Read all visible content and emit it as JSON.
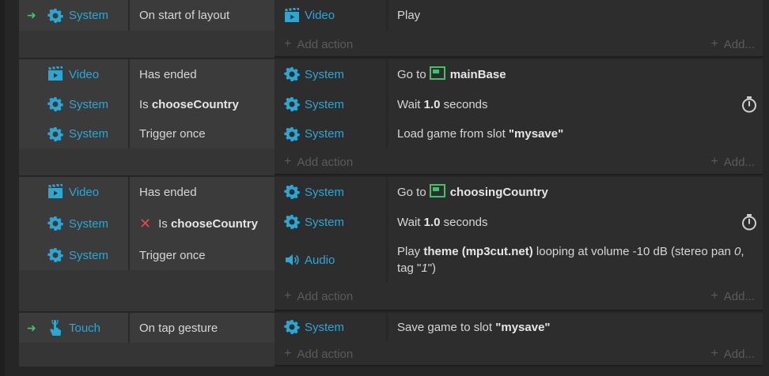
{
  "add_action_label": "Add action",
  "add_right_label": "Add...",
  "colors": {
    "object": "#29a8d6",
    "trigger": "#3fc36a",
    "negate": "#e84848",
    "muted": "#5b5b5b"
  },
  "events": [
    {
      "conditions": [
        {
          "trigger": true,
          "icon": "gear-icon",
          "object": "System",
          "text": "On start of layout"
        }
      ],
      "actions": [
        {
          "icon": "film-icon",
          "object": "Video",
          "text": "Play"
        }
      ]
    },
    {
      "conditions": [
        {
          "icon": "film-icon",
          "object": "Video",
          "text": "Has ended"
        },
        {
          "icon": "gear-icon",
          "object": "System",
          "prefix": "Is",
          "bold": "chooseCountry"
        },
        {
          "icon": "gear-icon",
          "object": "System",
          "text": "Trigger once"
        }
      ],
      "actions": [
        {
          "icon": "gear-icon",
          "object": "System",
          "prefix": "Go to",
          "layout": "mainBase"
        },
        {
          "icon": "gear-icon",
          "object": "System",
          "prefix": "Wait",
          "bold": "1.0",
          "suffix": "seconds",
          "timer": true
        },
        {
          "icon": "gear-icon",
          "object": "System",
          "prefix": "Load game from slot",
          "bold": "\"mysave\""
        }
      ]
    },
    {
      "conditions": [
        {
          "icon": "film-icon",
          "object": "Video",
          "text": "Has ended"
        },
        {
          "icon": "gear-icon",
          "object": "System",
          "negated": true,
          "prefix": "Is",
          "bold": "chooseCountry"
        },
        {
          "icon": "gear-icon",
          "object": "System",
          "text": "Trigger once"
        }
      ],
      "actions": [
        {
          "icon": "gear-icon",
          "object": "System",
          "prefix": "Go to",
          "layout": "choosingCountry"
        },
        {
          "icon": "gear-icon",
          "object": "System",
          "prefix": "Wait",
          "bold": "1.0",
          "suffix": "seconds",
          "timer": true
        },
        {
          "icon": "speaker-icon",
          "object": "Audio",
          "prefix": "Play",
          "bold": "theme (mp3cut.net)",
          "suffix": "looping at volume -10 dB (stereo pan",
          "italic1": "0",
          "mid": ", tag \"",
          "italic2": "1",
          "end": "\")"
        }
      ]
    },
    {
      "conditions": [
        {
          "trigger": true,
          "icon": "touch-icon",
          "object": "Touch",
          "text": "On tap gesture"
        }
      ],
      "actions": [
        {
          "icon": "gear-icon",
          "object": "System",
          "prefix": "Save game to slot",
          "bold": "\"mysave\""
        }
      ]
    }
  ]
}
